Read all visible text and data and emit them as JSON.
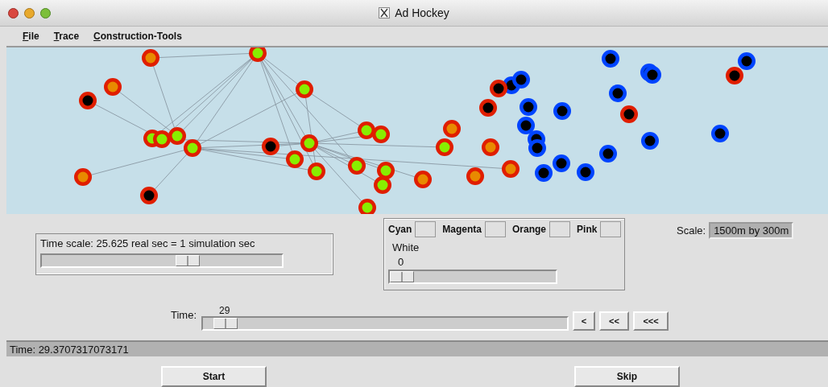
{
  "window": {
    "title": "Ad Hockey"
  },
  "menu": [
    {
      "label": "File"
    },
    {
      "label": "Trace"
    },
    {
      "label": "Construction-Tools"
    }
  ],
  "time_scale": {
    "label": "Time scale: 25.625 real sec = 1 simulation sec",
    "level": 0.62
  },
  "colors": {
    "fields": [
      {
        "label": "Cyan"
      },
      {
        "label": "Magenta"
      },
      {
        "label": "Orange"
      },
      {
        "label": "Pink"
      }
    ],
    "white": {
      "label": "White",
      "reading": "0",
      "level": 0
    }
  },
  "scale": {
    "label": "Scale:",
    "value": "1500m by 300m"
  },
  "time": {
    "label": "Time:",
    "reading": "29",
    "level": 0.03
  },
  "step_buttons": [
    "<",
    "<<",
    "<<<"
  ],
  "status_bar": "Time: 29.3707317073171",
  "buttons": [
    "Start",
    "Skip"
  ]
}
